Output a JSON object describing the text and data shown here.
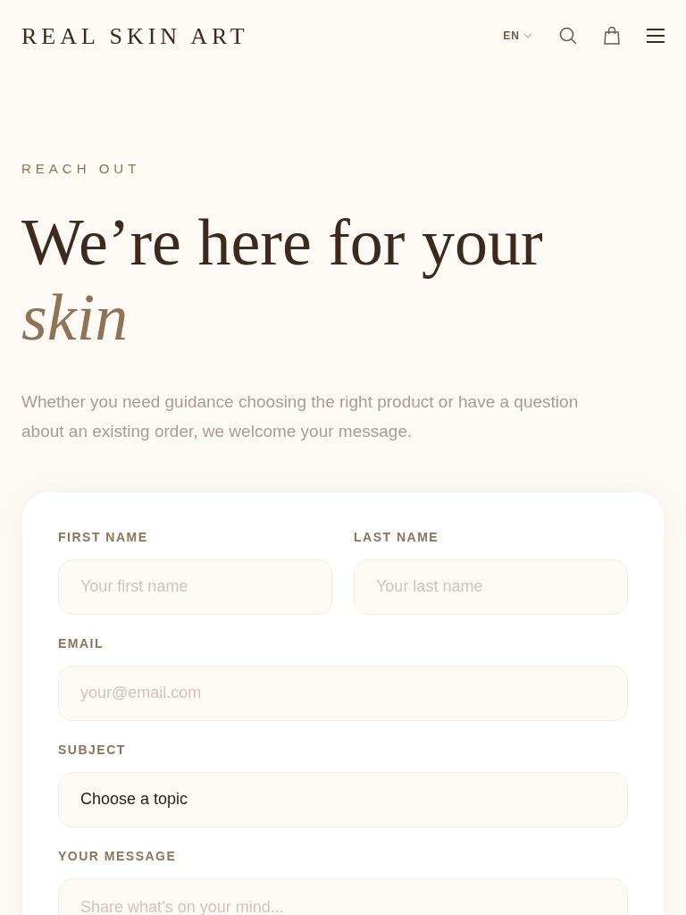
{
  "header": {
    "logo": "REAL SKIN ART",
    "language": "EN"
  },
  "hero": {
    "eyebrow": "REACH OUT",
    "title": "We’re here for your",
    "title_accent": "skin",
    "intro": "Whether you need guidance choosing the right product or have a question about an existing order, we welcome your message."
  },
  "form": {
    "rows": [
      [
        {
          "kind": "input",
          "label": "FIRST NAME",
          "placeholder": "Your first name"
        },
        {
          "kind": "input",
          "label": "LAST NAME",
          "placeholder": "Your last name"
        }
      ],
      [
        {
          "kind": "input",
          "label": "EMAIL",
          "placeholder": "your@email.com"
        }
      ],
      [
        {
          "kind": "select",
          "label": "SUBJECT",
          "value": "Choose a topic"
        }
      ],
      [
        {
          "kind": "textarea",
          "label": "YOUR MESSAGE",
          "placeholder": "Share what’s on your mind..."
        }
      ]
    ]
  }
}
